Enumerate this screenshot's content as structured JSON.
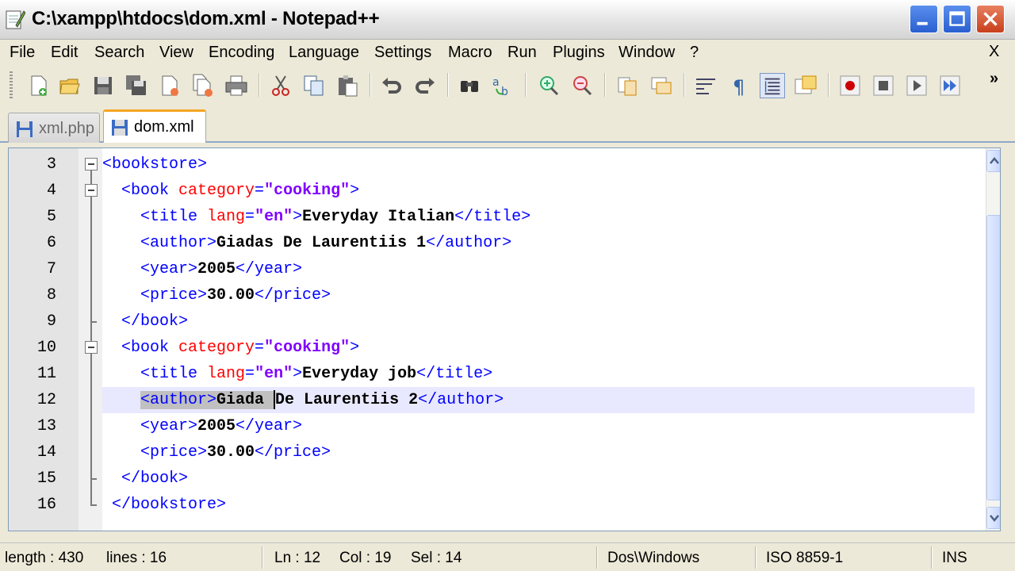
{
  "window": {
    "title": "C:\\xampp\\htdocs\\dom.xml - Notepad++"
  },
  "menu": {
    "items": [
      "File",
      "Edit",
      "Search",
      "View",
      "Encoding",
      "Language",
      "Settings",
      "Macro",
      "Run",
      "Plugins",
      "Window",
      "?"
    ],
    "close": "X"
  },
  "toolbar": {
    "icons": [
      "new-file-icon",
      "open-file-icon",
      "save-icon",
      "save-all-icon",
      "close-icon",
      "close-all-icon",
      "print-icon",
      "cut-icon",
      "copy-icon",
      "paste-icon",
      "undo-icon",
      "redo-icon",
      "find-icon",
      "replace-icon",
      "zoom-in-icon",
      "zoom-out-icon",
      "sync-v-icon",
      "sync-h-icon",
      "word-wrap-icon",
      "show-all-chars-icon",
      "indent-guide-icon",
      "user-lang-icon",
      "record-macro-icon",
      "stop-macro-icon",
      "play-macro-icon",
      "run-macro-multiple-icon"
    ],
    "more": "»"
  },
  "tabs": [
    {
      "label": "xml.php",
      "active": false
    },
    {
      "label": "dom.xml",
      "active": true
    }
  ],
  "editor": {
    "current_line": 12,
    "lines": [
      {
        "num": "3",
        "segments": [
          [
            "t",
            "<bookstore>"
          ]
        ]
      },
      {
        "num": "4",
        "segments": [
          [
            "s",
            "  "
          ],
          [
            "t",
            "<book "
          ],
          [
            "a",
            "category"
          ],
          [
            "t",
            "="
          ],
          [
            "v",
            "\"cooking\""
          ],
          [
            "t",
            ">"
          ]
        ]
      },
      {
        "num": "5",
        "segments": [
          [
            "s",
            "    "
          ],
          [
            "t",
            "<title "
          ],
          [
            "a",
            "lang"
          ],
          [
            "t",
            "="
          ],
          [
            "v",
            "\"en\""
          ],
          [
            "t",
            ">"
          ],
          [
            "p",
            "Everyday Italian"
          ],
          [
            "t",
            "</title>"
          ]
        ]
      },
      {
        "num": "6",
        "segments": [
          [
            "s",
            "    "
          ],
          [
            "t",
            "<author>"
          ],
          [
            "p",
            "Giadas De Laurentiis 1"
          ],
          [
            "t",
            "</author>"
          ]
        ]
      },
      {
        "num": "7",
        "segments": [
          [
            "s",
            "    "
          ],
          [
            "t",
            "<year>"
          ],
          [
            "p",
            "2005"
          ],
          [
            "t",
            "</year>"
          ]
        ]
      },
      {
        "num": "8",
        "segments": [
          [
            "s",
            "    "
          ],
          [
            "t",
            "<price>"
          ],
          [
            "p",
            "30.00"
          ],
          [
            "t",
            "</price>"
          ]
        ]
      },
      {
        "num": "9",
        "segments": [
          [
            "s",
            "  "
          ],
          [
            "t",
            "</book>"
          ]
        ]
      },
      {
        "num": "10",
        "segments": [
          [
            "s",
            "  "
          ],
          [
            "t",
            "<book "
          ],
          [
            "a",
            "category"
          ],
          [
            "t",
            "="
          ],
          [
            "v",
            "\"cooking\""
          ],
          [
            "t",
            ">"
          ]
        ]
      },
      {
        "num": "11",
        "segments": [
          [
            "s",
            "    "
          ],
          [
            "t",
            "<title "
          ],
          [
            "a",
            "lang"
          ],
          [
            "t",
            "="
          ],
          [
            "v",
            "\"en\""
          ],
          [
            "t",
            ">"
          ],
          [
            "p",
            "Everyday job"
          ],
          [
            "t",
            "</title>"
          ]
        ]
      },
      {
        "num": "12",
        "segments": [
          [
            "s",
            "    "
          ],
          [
            "ts",
            "<author>"
          ],
          [
            "ps",
            "Giada "
          ],
          [
            "c",
            ""
          ],
          [
            "p",
            "De Laurentiis 2"
          ],
          [
            "t",
            "</author>"
          ]
        ]
      },
      {
        "num": "13",
        "segments": [
          [
            "s",
            "    "
          ],
          [
            "t",
            "<year>"
          ],
          [
            "p",
            "2005"
          ],
          [
            "t",
            "</year>"
          ]
        ]
      },
      {
        "num": "14",
        "segments": [
          [
            "s",
            "    "
          ],
          [
            "t",
            "<price>"
          ],
          [
            "p",
            "30.00"
          ],
          [
            "t",
            "</price>"
          ]
        ]
      },
      {
        "num": "15",
        "segments": [
          [
            "s",
            "  "
          ],
          [
            "t",
            "</book>"
          ]
        ]
      },
      {
        "num": "16",
        "segments": [
          [
            "s",
            " "
          ],
          [
            "t",
            "</bookstore>"
          ]
        ]
      }
    ]
  },
  "status": {
    "length": "length : 430",
    "lines": "lines : 16",
    "ln": "Ln : 12",
    "col": "Col : 19",
    "sel": "Sel : 14",
    "eol": "Dos\\Windows",
    "encoding": "ISO 8859-1",
    "mode": "INS"
  },
  "colors": {
    "tag": "#0000ff",
    "attribute": "#ff0000",
    "value": "#8000ff",
    "current_line": "#e8e8ff",
    "tab_accent": "#f5a623"
  }
}
